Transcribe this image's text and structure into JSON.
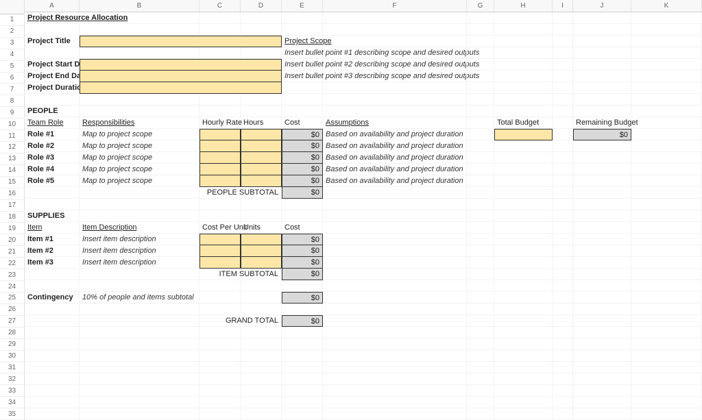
{
  "columns": [
    "A",
    "B",
    "C",
    "D",
    "E",
    "F",
    "G",
    "H",
    "I",
    "J",
    "K"
  ],
  "rowCount": 35,
  "a1": "Project Resource Allocation",
  "labels": {
    "projectTitle": "Project Title",
    "projectStart": "Project Start Date",
    "projectEnd": "Project End Date",
    "projectDuration": "Project Duration",
    "projectScope": "Project Scope",
    "people": "PEOPLE",
    "teamRole": "Team Role",
    "responsibilities": "Responsibilities",
    "hourlyRate": "Hourly Rate",
    "hours": "Hours",
    "cost": "Cost",
    "assumptions": "Assumptions",
    "totalBudget": "Total Budget",
    "remainingBudget": "Remaining Budget",
    "peopleSubtotal": "PEOPLE SUBTOTAL",
    "supplies": "SUPPLIES",
    "item": "Item",
    "itemDesc": "Item Description",
    "costPerUnit": "Cost Per Unit",
    "units": "Units",
    "itemSubtotal": "ITEM SUBTOTAL",
    "contingency": "Contingency",
    "contingencyDesc": "10% of people and items subtotal",
    "grandTotal": "GRAND TOTAL"
  },
  "scope": [
    "Insert bullet point #1 describing scope and desired outputs",
    "Insert bullet point #2 describing scope and desired outputs",
    "Insert bullet point #3 describing scope and desired outputs"
  ],
  "people": [
    {
      "role": "Role #1",
      "resp": "Map to project scope",
      "cost": "$0",
      "assume": "Based on availability and project duration"
    },
    {
      "role": "Role #2",
      "resp": "Map to project scope",
      "cost": "$0",
      "assume": "Based on availability and project duration"
    },
    {
      "role": "Role #3",
      "resp": "Map to project scope",
      "cost": "$0",
      "assume": "Based on availability and project duration"
    },
    {
      "role": "Role #4",
      "resp": "Map to project scope",
      "cost": "$0",
      "assume": "Based on availability and project duration"
    },
    {
      "role": "Role #5",
      "resp": "Map to project scope",
      "cost": "$0",
      "assume": "Based on availability and project duration"
    }
  ],
  "peopleSubtotalVal": "$0",
  "supplies_items": [
    {
      "item": "Item #1",
      "desc": "Insert item description",
      "cost": "$0"
    },
    {
      "item": "Item #2",
      "desc": "Insert item description",
      "cost": "$0"
    },
    {
      "item": "Item #3",
      "desc": "Insert item description",
      "cost": "$0"
    }
  ],
  "itemSubtotalVal": "$0",
  "contingencyVal": "$0",
  "grandTotalVal": "$0",
  "remainingBudgetVal": "$0"
}
